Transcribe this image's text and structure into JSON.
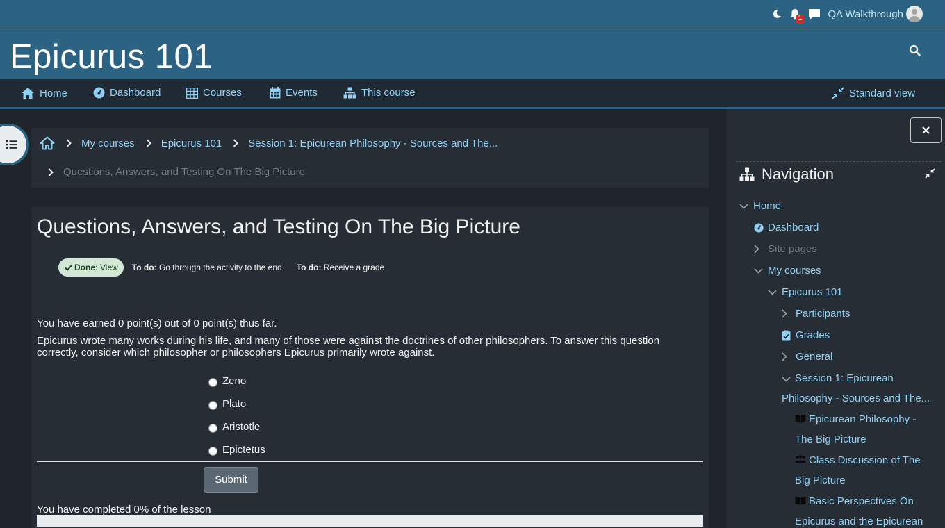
{
  "topbar": {
    "notification_count": "1",
    "user_name": "QA Walkthrough",
    "icons": [
      "moon-icon",
      "bell-icon",
      "chat-icon"
    ]
  },
  "header": {
    "site_title": "Epicurus 101"
  },
  "primary_nav": {
    "items": [
      {
        "label": "Home",
        "icon": "home-icon"
      },
      {
        "label": "Dashboard",
        "icon": "dashboard-icon"
      },
      {
        "label": "Courses",
        "icon": "grid-icon"
      },
      {
        "label": "Events",
        "icon": "calendar-icon"
      },
      {
        "label": "This course",
        "icon": "sitemap-icon"
      }
    ],
    "view_toggle": "Standard view"
  },
  "breadcrumb": {
    "items": [
      "My courses",
      "Epicurus 101",
      "Session 1: Epicurean Philosophy - Sources and The..."
    ],
    "current": "Questions, Answers, and Testing On The Big Picture"
  },
  "main": {
    "page_title": "Questions, Answers, and Testing On The Big Picture",
    "completion": {
      "done_label": "Done:",
      "done_value": "View",
      "todos": [
        {
          "label": "To do:",
          "value": "Go through the activity to the end"
        },
        {
          "label": "To do:",
          "value": "Receive a grade"
        }
      ]
    },
    "score_text": "You have earned 0 point(s) out of 0 point(s) thus far.",
    "question": "Epicurus wrote many works during his life, and many of those were against the doctrines of other philosophers. To answer this question correctly, consider which philosopher or philosophers Epicurus primarily wrote against.",
    "answers": [
      "Zeno",
      "Plato",
      "Aristotle",
      "Epictetus"
    ],
    "submit_label": "Submit",
    "progress_text": "You have completed 0% of the lesson",
    "progress_value": 0
  },
  "right_drawer": {
    "title": "Navigation",
    "tree": {
      "home": "Home",
      "dashboard": "Dashboard",
      "site_pages": "Site pages",
      "my_courses": "My courses",
      "course": "Epicurus 101",
      "participants": "Participants",
      "grades": "Grades",
      "general": "General",
      "session_line1": "Session 1: Epicurean",
      "session_line2": "Philosophy - Sources and The...",
      "activity1_line1": "Epicurean Philosophy -",
      "activity1_line2": "The Big Picture",
      "activity2_line1": "Class Discussion of The",
      "activity2_line2": "Big Picture",
      "activity3_line1": "Basic Perspectives On",
      "activity3_line2": "Epicurus and the Epicurean"
    }
  },
  "colors": {
    "brand": "#2c6382",
    "link": "#8fd0f5",
    "background": "#1f252b",
    "panel": "#262d35",
    "done_pill": "#d2e8d4"
  }
}
